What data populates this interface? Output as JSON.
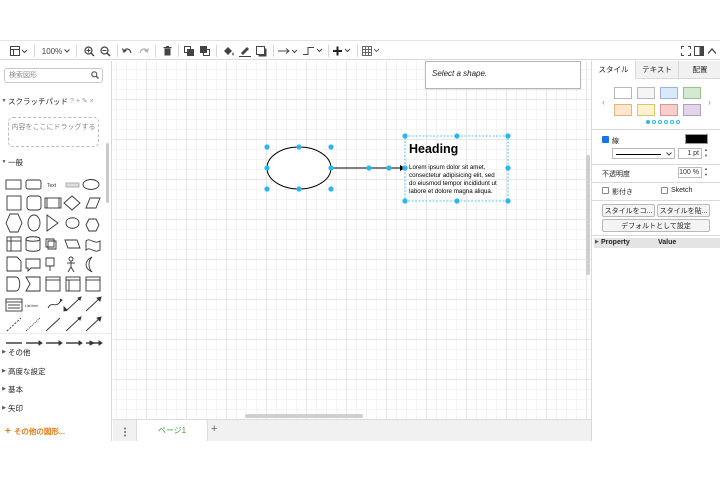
{
  "toolbar": {
    "zoom": "100%",
    "icons": [
      "view-icon",
      "zoom-in-icon",
      "zoom-out-icon",
      "undo-icon",
      "redo-icon",
      "delete-icon",
      "to-front-icon",
      "to-back-icon",
      "fill-color-icon",
      "line-color-icon",
      "shadow-icon",
      "connection-icon",
      "waypoints-icon",
      "insert-icon",
      "table-icon",
      "fullscreen-icon",
      "format-panel-icon",
      "collapse-icon"
    ]
  },
  "sidebar": {
    "search_placeholder": "検索図形",
    "scratchpad_title": "スクラッチパッド",
    "scratchpad_actions": "? + ✎ ×",
    "scratchpad_drop": "内容をここにドラッグする",
    "general_title": "一般",
    "shape_labels": {
      "text": "Text",
      "list_item": "List Item"
    },
    "sections": [
      "その他",
      "高度な設定",
      "基本",
      "矢印"
    ],
    "more_shapes": "その他の図形..."
  },
  "canvas": {
    "tooltip": "Select a shape.",
    "textbox": {
      "heading": "Heading",
      "body_lines": [
        "Lorem ipsum dolor sit amet,",
        "consectetur adipisicing elit, sed",
        "do eiusmod tempor incididunt ut",
        "labore et dolore magna aliqua."
      ]
    },
    "selection_color": "#29b6f2"
  },
  "pages": {
    "active": "ページ1",
    "add": "+"
  },
  "format_panel": {
    "tabs": [
      "スタイル",
      "テキスト",
      "配置"
    ],
    "swatches": [
      "#ffffff",
      "#f5f5f5",
      "#dae8fc",
      "#d5e8d4",
      "#ffe6cc",
      "#fff2cc",
      "#f8cecc",
      "#e1d5e7"
    ],
    "line_label": "線",
    "line_color": "#000000",
    "line_width": "1 pt",
    "opacity_label": "不透明度",
    "opacity_value": "100 %",
    "shadow_label": "影付き",
    "sketch_label": "Sketch",
    "copy_style": "スタイルをコ...",
    "paste_style": "スタイルを貼...",
    "set_default": "デフォルトとして設定",
    "property_col": "Property",
    "value_col": "Value"
  }
}
